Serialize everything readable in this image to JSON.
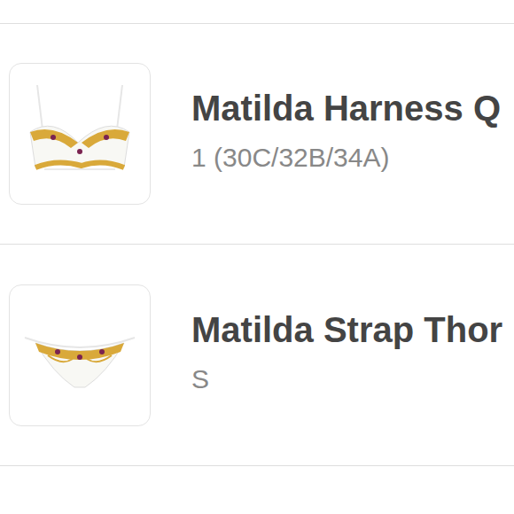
{
  "items": [
    {
      "title": "Matilda Harness Q",
      "variant": "1 (30C/32B/34A)",
      "kind": "bra"
    },
    {
      "title": "Matilda Strap Thor",
      "variant": "S",
      "kind": "thong"
    }
  ]
}
